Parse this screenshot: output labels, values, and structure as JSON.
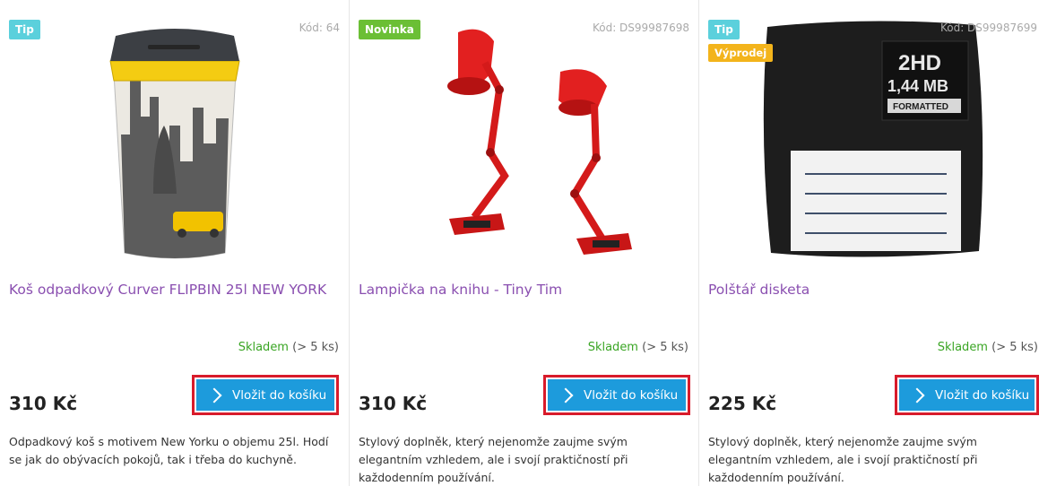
{
  "products": [
    {
      "badges": [
        "Tip"
      ],
      "code": "Kód: 64",
      "title": "Koš odpadkový Curver FLIPBIN 25l NEW YORK",
      "availability": "Skladem",
      "availability_detail": "(> 5 ks)",
      "price": "310 Kč",
      "cart_label": "Vložit do košíku",
      "description": "Odpadkový koš s motivem New Yorku o objemu 25l. Hodí se jak do obývacích pokojů, tak i třeba do kuchyně.",
      "image_icon": "trash-bin-image"
    },
    {
      "badges": [
        "Novinka"
      ],
      "code": "Kód: DS99987698",
      "title": "Lampička na knihu - Tiny Tim",
      "availability": "Skladem",
      "availability_detail": "(> 5 ks)",
      "price": "310 Kč",
      "cart_label": "Vložit do košíku",
      "description": "Stylový doplněk, který nejenomže zaujme svým elegantním vzhledem, ale i svojí praktičností při každodenním používání.",
      "image_icon": "book-lamp-image"
    },
    {
      "badges": [
        "Tip",
        "Výprodej"
      ],
      "code": "Kód: DS99987699",
      "title": "Polštář disketa",
      "availability": "Skladem",
      "availability_detail": "(> 5 ks)",
      "price": "225 Kč",
      "cart_label": "Vložit do košíku",
      "description": "Stylový doplněk, který nejenomže zaujme svým elegantním vzhledem, ale i svojí praktičností při každodenním používání.",
      "image_icon": "floppy-pillow-image",
      "image_text": {
        "line1": "2HD",
        "line2": "1,44 MB",
        "line3": "FORMATTED"
      }
    }
  ],
  "colors": {
    "title": "#8a4fb0",
    "in_stock": "#3aa524",
    "button": "#1d9bdc",
    "button_outline": "#d81b2b",
    "badge_tip": "#5bd0dc",
    "badge_novinka": "#6bbf35",
    "badge_vyprodej": "#f3b41b"
  }
}
